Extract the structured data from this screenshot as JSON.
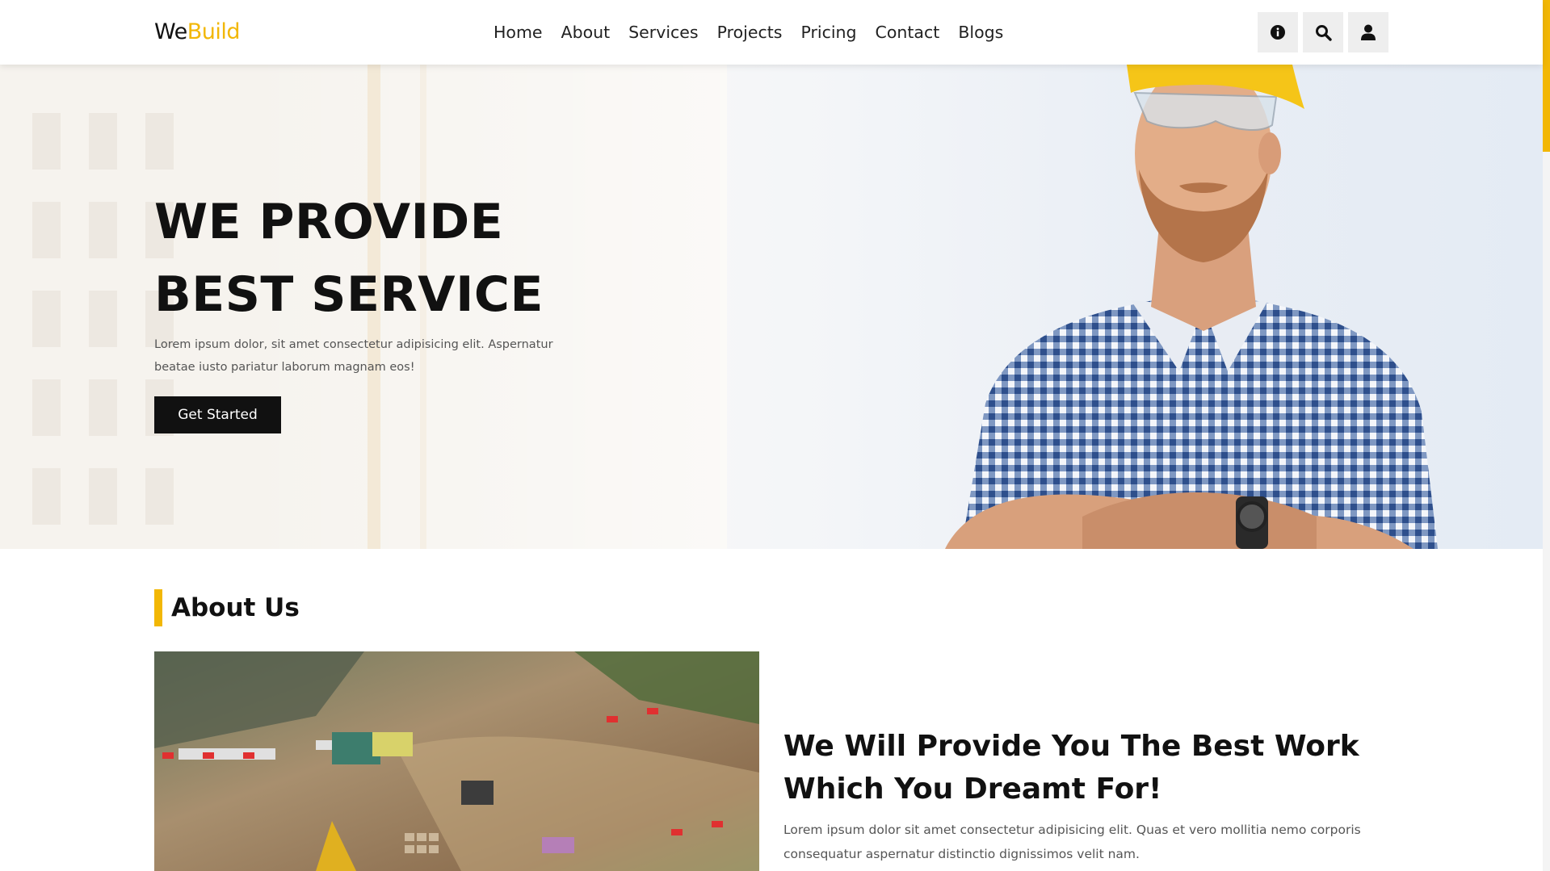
{
  "brand": {
    "part1": "We",
    "part2": "Build",
    "accent_color": "#f2b705"
  },
  "nav": [
    "Home",
    "About",
    "Services",
    "Projects",
    "Pricing",
    "Contact",
    "Blogs"
  ],
  "header_icons": [
    "info-icon",
    "search-icon",
    "user-icon"
  ],
  "hero": {
    "title_line1": "WE PROVIDE",
    "title_line2": "BEST SERVICE",
    "text": "Lorem ipsum dolor, sit amet consectetur adipisicing elit. Aspernatur beatae iusto pariatur laborum magnam eos!",
    "button": "Get Started",
    "slider_icons": [
      "chevron-left-icon",
      "chevron-right-icon"
    ]
  },
  "about": {
    "heading": "About Us",
    "title": "We Will Provide You The Best Work Which You Dreamt For!",
    "text": "Lorem ipsum dolor sit amet consectetur adipisicing elit. Quas et vero mollitia nemo corporis consequatur aspernatur distinctio dignissimos velit nam."
  }
}
